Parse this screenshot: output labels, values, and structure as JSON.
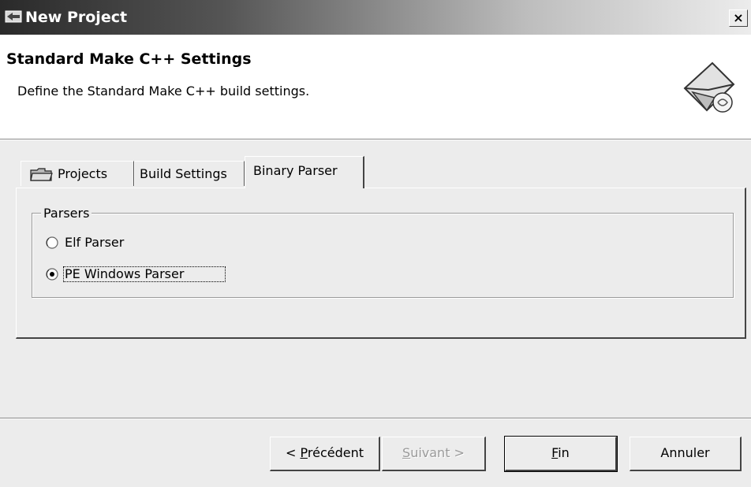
{
  "window": {
    "title": "New Project",
    "close_glyph": "×"
  },
  "banner": {
    "title": "Standard Make C++ Settings",
    "description": "Define the Standard Make C++ build settings.",
    "icon": "wizard-envelope-icon"
  },
  "tabs": [
    {
      "label": "Projects",
      "icon": "folder-icon",
      "active": false
    },
    {
      "label": "Build Settings",
      "active": false
    },
    {
      "label": "Binary Parser",
      "active": true
    }
  ],
  "parsers": {
    "group_label": "Parsers",
    "options": [
      {
        "label": "Elf Parser",
        "selected": false
      },
      {
        "label": "PE Windows Parser",
        "selected": true
      }
    ]
  },
  "buttons": {
    "back": {
      "prefix": "< ",
      "mnemonic": "P",
      "rest": "récédent"
    },
    "next": {
      "mnemonic": "S",
      "rest": "uivant >",
      "disabled": true
    },
    "finish": {
      "mnemonic": "F",
      "rest": "in"
    },
    "cancel": {
      "label": "Annuler"
    }
  }
}
